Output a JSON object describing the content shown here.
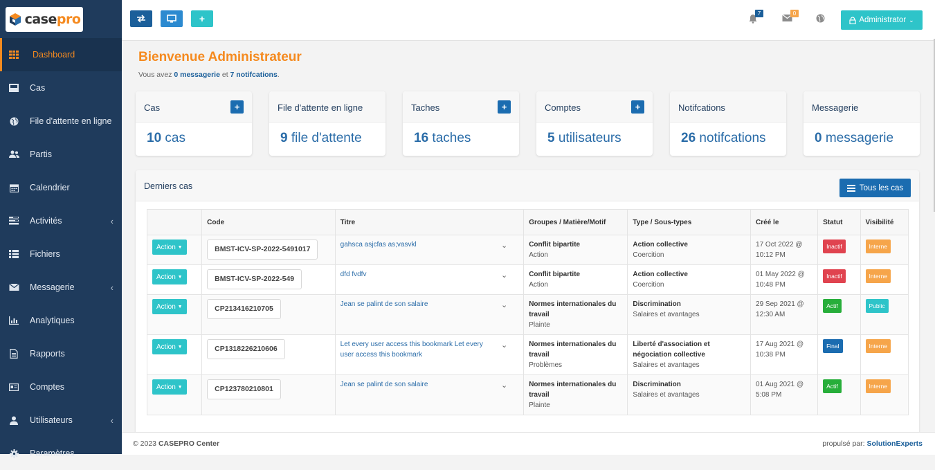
{
  "brand": {
    "case": "case",
    "pro": "pro"
  },
  "sidebar": {
    "items": [
      {
        "label": "Dashboard",
        "icon": "grid-icon",
        "active": true
      },
      {
        "label": "Cas",
        "icon": "inbox-icon"
      },
      {
        "label": "File d'attente en ligne",
        "icon": "globe-icon"
      },
      {
        "label": "Partis",
        "icon": "users-icon"
      },
      {
        "label": "Calendrier",
        "icon": "calendar-icon"
      },
      {
        "label": "Activités",
        "icon": "tasks-icon",
        "submenu": true
      },
      {
        "label": "Fichiers",
        "icon": "list-icon"
      },
      {
        "label": "Messagerie",
        "icon": "envelope-icon",
        "submenu": true
      },
      {
        "label": "Analytiques",
        "icon": "bar-chart-icon"
      },
      {
        "label": "Rapports",
        "icon": "file-icon"
      },
      {
        "label": "Comptes",
        "icon": "id-card-icon"
      },
      {
        "label": "Utilisateurs",
        "icon": "user-icon",
        "submenu": true
      },
      {
        "label": "Paramètres",
        "icon": "gear-icon"
      }
    ]
  },
  "topbar": {
    "notif_count": "7",
    "mail_count": "0",
    "admin_label": "Administrator"
  },
  "welcome": {
    "title": "Bienvenue Administrateur",
    "pre": "Vous avez ",
    "msg": "0 messagerie",
    "mid": " et ",
    "notif": "7 notifcations",
    "post": "."
  },
  "cards": [
    {
      "title": "Cas",
      "num": "10",
      "unit": "cas",
      "plus": true
    },
    {
      "title": "File d'attente en ligne",
      "num": "9",
      "unit": "file d'attente",
      "plus": false
    },
    {
      "title": "Taches",
      "num": "16",
      "unit": "taches",
      "plus": true
    },
    {
      "title": "Comptes",
      "num": "5",
      "unit": "utilisateurs",
      "plus": true
    },
    {
      "title": "Notifcations",
      "num": "26",
      "unit": "notifcations",
      "plus": false
    },
    {
      "title": "Messagerie",
      "num": "0",
      "unit": "messagerie",
      "plus": false
    }
  ],
  "panel": {
    "title": "Derniers cas",
    "all_button": "Tous les cas"
  },
  "table": {
    "headers": [
      "",
      "Code",
      "Titre",
      "Groupes / Matière/Motif",
      "Type / Sous-types",
      "Créé le",
      "Statut",
      "Visibilité"
    ],
    "action_label": "Action",
    "rows": [
      {
        "code": "BMST-ICV-SP-2022-5491017",
        "title": "gahsca asjcfas as;vasvkl",
        "group": "Conflit bipartite",
        "group_sub": "Action",
        "type": "Action collective",
        "type_sub": "Coercition",
        "date": "17 Oct 2022 @",
        "time": "10:12 PM",
        "status": "Inactif",
        "status_color": "#e0434f",
        "vis": "Interne",
        "vis_color": "#f6a54a"
      },
      {
        "code": "BMST-ICV-SP-2022-549",
        "title": "dfd fvdfv",
        "group": "Conflit bipartite",
        "group_sub": "Action",
        "type": "Action collective",
        "type_sub": "Coercition",
        "date": "01 May 2022 @",
        "time": "10:48 PM",
        "status": "Inactif",
        "status_color": "#e0434f",
        "vis": "Interne",
        "vis_color": "#f6a54a"
      },
      {
        "code": "CP213416210705",
        "title": "Jean se palint de son salaire",
        "group": "Normes internationales du travail",
        "group_sub": "Plainte",
        "type": "Discrimination",
        "type_sub": "Salaires et avantages",
        "date": "29 Sep 2021 @",
        "time": "12:30 AM",
        "status": "Actif",
        "status_color": "#27ae3a",
        "vis": "Public",
        "vis_color": "#2ec4c9"
      },
      {
        "code": "CP1318226210606",
        "title": "Let every user access this bookmark Let every user access this bookmark",
        "group": "Normes internationales du travail",
        "group_sub": "Problèmes",
        "type": "Liberté d'association et négociation collective",
        "type_sub": "Salaires et avantages",
        "date": "17 Aug 2021 @",
        "time": "10:38 PM",
        "status": "Final",
        "status_color": "#1b6cb0",
        "vis": "Interne",
        "vis_color": "#f6a54a"
      },
      {
        "code": "CP123780210801",
        "title": "Jean se palint de son salaire",
        "group": "Normes internationales du travail",
        "group_sub": "Plainte",
        "type": "Discrimination",
        "type_sub": "Salaires et avantages",
        "date": "01 Aug 2021 @",
        "time": "5:08 PM",
        "status": "Actif",
        "status_color": "#27ae3a",
        "vis": "Interne",
        "vis_color": "#f6a54a"
      }
    ]
  },
  "footer": {
    "left_pre": "© 2023 ",
    "left_brand": "CASEPRO Center",
    "right_pre": "propulsé par: ",
    "right_brand": "SolutionExperts"
  }
}
